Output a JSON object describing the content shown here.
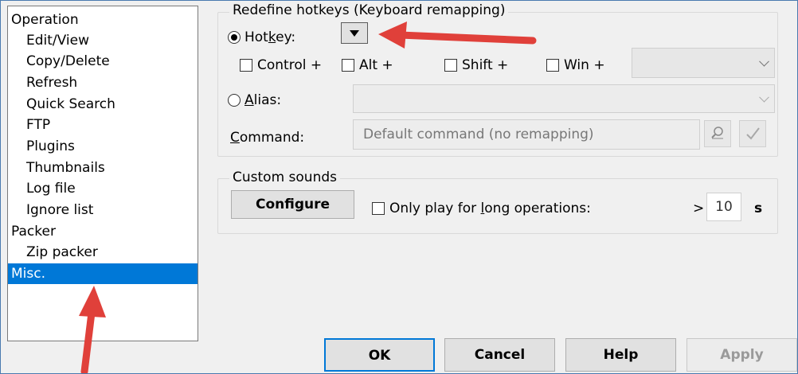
{
  "tree": {
    "items": [
      {
        "label": "Operation",
        "level": 0
      },
      {
        "label": "Edit/View",
        "level": 1
      },
      {
        "label": "Copy/Delete",
        "level": 1
      },
      {
        "label": "Refresh",
        "level": 1
      },
      {
        "label": "Quick Search",
        "level": 1
      },
      {
        "label": "FTP",
        "level": 1
      },
      {
        "label": "Plugins",
        "level": 1
      },
      {
        "label": "Thumbnails",
        "level": 1
      },
      {
        "label": "Log file",
        "level": 1
      },
      {
        "label": "Ignore list",
        "level": 1
      },
      {
        "label": "Packer",
        "level": 0
      },
      {
        "label": "Zip packer",
        "level": 1
      },
      {
        "label": "Misc.",
        "level": 0,
        "selected": true
      }
    ]
  },
  "hotkeys": {
    "group_title": "Redefine hotkeys (Keyboard remapping)",
    "hotkey_label_pre": "Hot",
    "hotkey_label_u": "k",
    "hotkey_label_post": "ey:",
    "control_label": "Control +",
    "alt_label": "Alt +",
    "shift_label": "Shift +",
    "win_label": "Win +",
    "key_select_value": "",
    "alias_label_u": "A",
    "alias_label_post": "lias:",
    "alias_value": "",
    "command_label_u": "C",
    "command_label_post": "ommand:",
    "command_placeholder": "Default command (no remapping)"
  },
  "sounds": {
    "group_title": "Custom sounds",
    "configure_pre": "Confi",
    "configure_u": "g",
    "configure_post": "ure",
    "long_ops_pre": "Only play for ",
    "long_ops_u": "l",
    "long_ops_post": "ong operations:",
    "gt": ">",
    "seconds_value": "10",
    "seconds_unit": "s"
  },
  "footer": {
    "ok": "OK",
    "cancel": "Cancel",
    "help": "Help",
    "apply": "Apply"
  },
  "colors": {
    "selection": "#0078d7",
    "arrow": "#e0403a"
  }
}
